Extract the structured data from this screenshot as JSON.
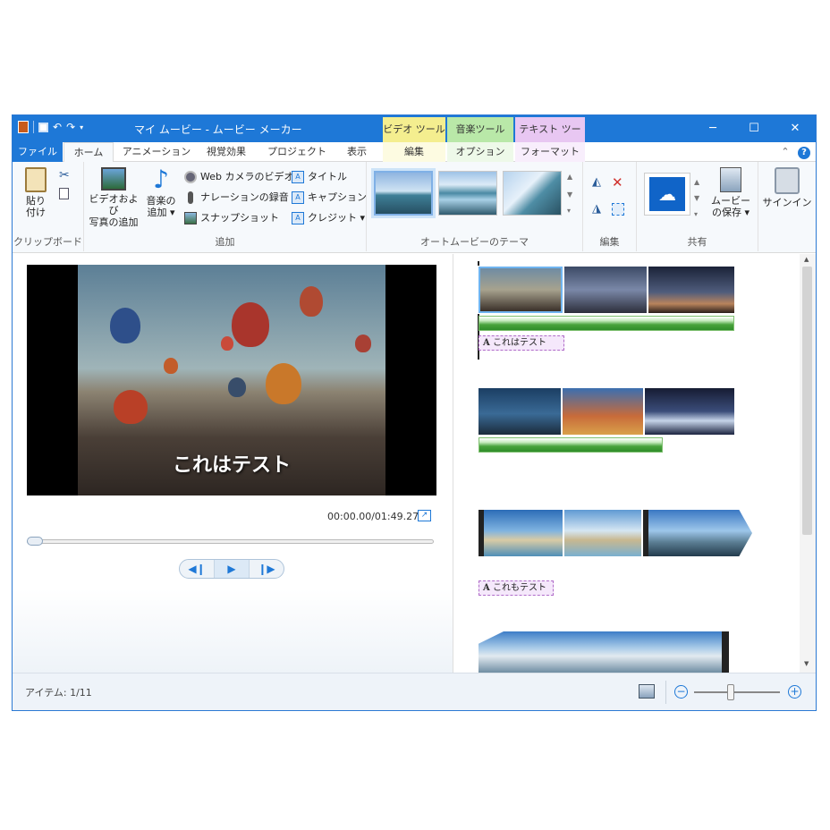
{
  "window": {
    "title": "マイ ムービー - ムービー メーカー",
    "qat": [
      "save-icon",
      "undo-icon",
      "redo-icon",
      "customize-icon"
    ],
    "controls": [
      "─",
      "☐",
      "✕"
    ]
  },
  "context_tabs": {
    "video": "ビデオ ツール",
    "music": "音楽ツール",
    "text": "テキスト ツール"
  },
  "tabs": {
    "file": "ファイル",
    "home": "ホーム",
    "animation": "アニメーション",
    "effects": "視覚効果",
    "project": "プロジェクト",
    "view": "表示",
    "edit": "編集",
    "options": "オプション",
    "format": "フォーマット"
  },
  "ribbon": {
    "clipboard": {
      "paste_line1": "貼り",
      "paste_line2": "付け",
      "label": "クリップボード"
    },
    "add": {
      "add_video_line1": "ビデオおよび",
      "add_video_line2": "写真の追加",
      "add_music_line1": "音楽の",
      "add_music_line2": "追加 ▾",
      "webcam": "Web カメラのビデオ",
      "narration": "ナレーションの録音 ▾",
      "snapshot": "スナップショット",
      "title": "タイトル",
      "caption": "キャプション",
      "credits": "クレジット ▾",
      "label": "追加"
    },
    "automovie": {
      "label": "オートムービーのテーマ"
    },
    "edit": {
      "label": "編集"
    },
    "share": {
      "save_line1": "ムービー",
      "save_line2": "の保存 ▾",
      "label": "共有"
    },
    "signin": {
      "label": "サインイン"
    }
  },
  "preview": {
    "caption": "これはテスト",
    "timecode": "00:00.00/01:49.27"
  },
  "storyboard": {
    "text_clips": [
      "これはテスト",
      "これもテスト"
    ]
  },
  "status": {
    "items": "アイテム: 1/11",
    "zoom_minus": "−",
    "zoom_plus": "+"
  },
  "colors": {
    "accent": "#1e78d7",
    "video_tools": "#f4ee8f",
    "music_tools": "#b9e8a8",
    "text_tools": "#e8c7f2"
  }
}
